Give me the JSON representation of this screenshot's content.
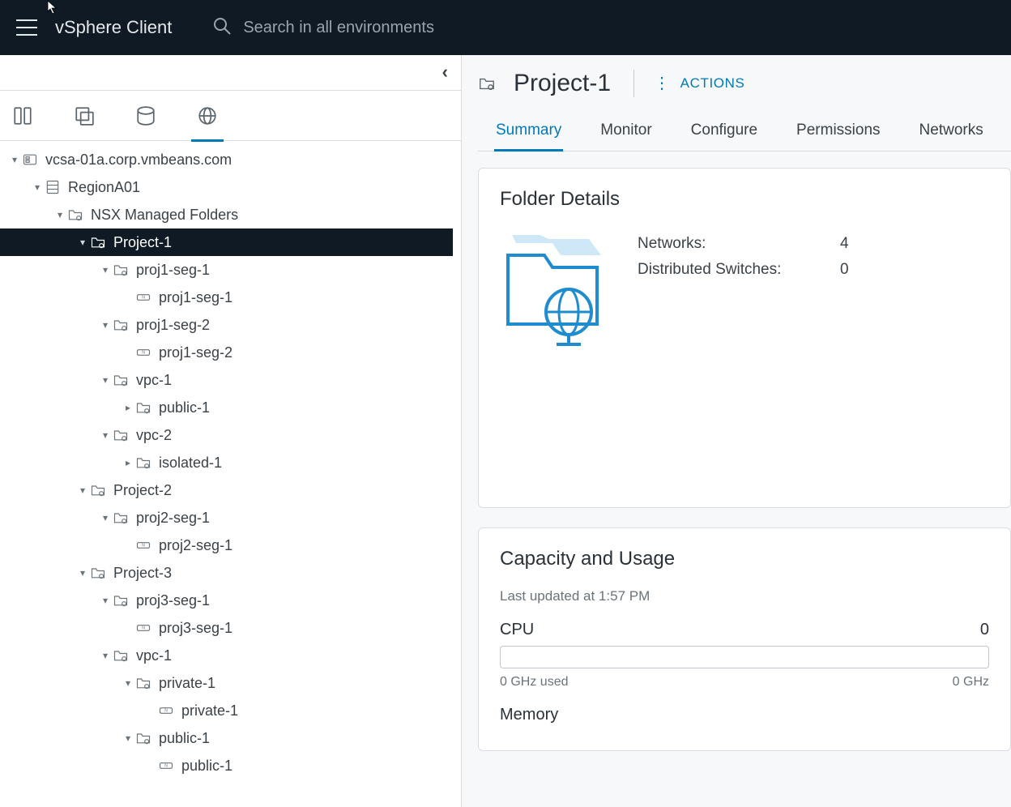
{
  "header": {
    "app_title": "vSphere Client",
    "search_placeholder": "Search in all environments"
  },
  "tree": {
    "root": "vcsa-01a.corp.vmbeans.com",
    "datacenter": "RegionA01",
    "nsx_folder": "NSX Managed Folders",
    "p1": "Project-1",
    "p1s1": "proj1-seg-1",
    "p1s1n": "proj1-seg-1",
    "p1s2": "proj1-seg-2",
    "p1s2n": "proj1-seg-2",
    "p1v1": "vpc-1",
    "p1v1pub": "public-1",
    "p1v2": "vpc-2",
    "p1v2iso": "isolated-1",
    "p2": "Project-2",
    "p2s1": "proj2-seg-1",
    "p2s1n": "proj2-seg-1",
    "p3": "Project-3",
    "p3s1": "proj3-seg-1",
    "p3s1n": "proj3-seg-1",
    "p3v1": "vpc-1",
    "p3v1priv": "private-1",
    "p3v1privn": "private-1",
    "p3v1pub": "public-1",
    "p3v1pubn": "public-1"
  },
  "page": {
    "title": "Project-1",
    "actions_label": "ACTIONS",
    "tabs": {
      "summary": "Summary",
      "monitor": "Monitor",
      "configure": "Configure",
      "permissions": "Permissions",
      "networks": "Networks"
    }
  },
  "details": {
    "card_title": "Folder Details",
    "networks_label": "Networks:",
    "networks_value": "4",
    "dswitch_label": "Distributed Switches:",
    "dswitch_value": "0"
  },
  "capacity": {
    "card_title": "Capacity and Usage",
    "updated": "Last updated at 1:57 PM",
    "cpu_label": "CPU",
    "cpu_right": "0",
    "cpu_used": "0 GHz used",
    "cpu_free": "0 GHz",
    "mem_label": "Memory"
  }
}
